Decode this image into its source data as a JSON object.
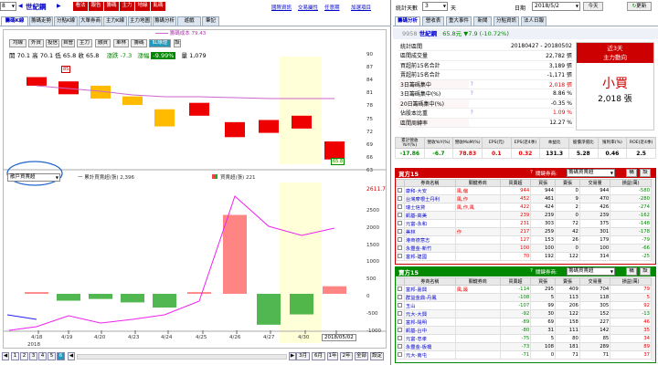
{
  "left": {
    "stock_select": "8",
    "stock_name": "世紀鋼",
    "toolbar": [
      "看法",
      "報告",
      "籌碼",
      "主力",
      "地緣",
      "亂碼"
    ],
    "links": [
      "國際資訊",
      "交易屬性",
      "任意期",
      "加選項目"
    ],
    "tabs": [
      "籌碼K線",
      "籌碼走勢",
      "分點K線",
      "大單券商",
      "主力K線",
      "主力地圖",
      "籌碼分析",
      "遊戲",
      "筆記"
    ],
    "subtabs": [
      "均線",
      "外資",
      "投信",
      "自營",
      "主力",
      "融資",
      "車林",
      "籌碼",
      "紅綠燈",
      "設"
    ],
    "active_subtab": "紅綠燈",
    "ma_legend": "籌碼成本 79.43",
    "ohlc": {
      "open": "開 70.1",
      "high": "高 70.1",
      "low": "低 65.8",
      "close": "收 65.8",
      "chg_label": "漲跌 -7.3",
      "pct_label": "漲幅",
      "pct": "-9.99%",
      "vol_label": "量",
      "vol": "1,079"
    },
    "high_marker": "85",
    "low_marker": "65.8",
    "price_axis": [
      "90",
      "87",
      "84",
      "81",
      "78",
      "75",
      "72",
      "69",
      "66",
      "63"
    ],
    "indicator_select": "散戶買賣超",
    "legend1": "一 累計買賣超(張) 2,396",
    "legend2": "買賣超(張) 221",
    "vol_axis_top": "2611.7",
    "vol_axis": [
      "2500",
      "2000",
      "1500",
      "1000",
      "500",
      "0",
      "-500",
      "-1000"
    ],
    "dates": [
      "4/18",
      "4/19",
      "4/20",
      "4/23",
      "4/24",
      "4/25",
      "4/26",
      "4/27",
      "4/30",
      "5/02"
    ],
    "year": "2018",
    "cursor_date": "2018/05/02",
    "pages": [
      "1",
      "2",
      "3",
      "4",
      "5",
      "6"
    ],
    "active_page": "6",
    "periods": [
      "3月",
      "6月",
      "1年",
      "2年",
      "全部",
      "設定"
    ]
  },
  "right": {
    "top": {
      "date_label": "統計天數",
      "days": "3",
      "days_unit": "天",
      "date_title": "日期",
      "date": "2018/5/2",
      "today": "今天",
      "refresh": "更新"
    },
    "tabs": [
      "籌碼分析",
      "營收表",
      "重大事件",
      "新聞",
      "分點資訊",
      "法人日報"
    ],
    "stock": {
      "code": "9958",
      "name": "世紀鋼",
      "price": "65.8元",
      "change": "▼7.9 (-10.72%)"
    },
    "stats": [
      {
        "label": "統計區間",
        "value": "20180427 - 20180502"
      },
      {
        "label": "區間成交量",
        "value": "22,782 張"
      },
      {
        "label": "買超前15名合計",
        "value": "3,189 張"
      },
      {
        "label": "賣超前15名合計",
        "value": "-1,171 張"
      },
      {
        "label": "3日籌碼集中",
        "value": "2,018 張"
      },
      {
        "label": "3日籌碼集中(%)",
        "value": "8.86 %"
      },
      {
        "label": "20日籌碼集中(%)",
        "value": "-0.35 %"
      },
      {
        "label": "佔股本比重",
        "value": "1.09 %"
      },
      {
        "label": "區間周轉率",
        "value": "12.27 %"
      }
    ],
    "near_box": {
      "title": "近3天",
      "sub": "主力動向",
      "verdict": "小買",
      "amount": "2,018 張"
    },
    "fin_headers": [
      "累計營收YoY(%)",
      "營收YoY(%)",
      "營收MoM(%)",
      "EPS(元)",
      "EPS(近4季)",
      "本益比",
      "股價淨值比",
      "殖利率(%)",
      "ROE(近4季)"
    ],
    "fin_values": [
      "-17.86",
      "-6.7",
      "78.83",
      "0.1",
      "0.32",
      "131.3",
      "5.28",
      "0.46",
      "2.5"
    ],
    "buy": {
      "title": "買方15",
      "help": "?",
      "select_label": "關鍵券商:",
      "select": "籌碼買賣超",
      "btn1": "構",
      "btn2": "設",
      "headers": [
        "",
        "券商名稱",
        "關鍵券商",
        "買賣超",
        "買張",
        "賣張",
        "交易量",
        "損益(萬)"
      ],
      "rows": [
        [
          "",
          "康和-大安",
          "風,偏",
          "944",
          "944",
          "0",
          "944",
          "-580"
        ],
        [
          "",
          "台灣摩根士丹利",
          "風,作",
          "452",
          "461",
          "9",
          "470",
          "-280"
        ],
        [
          "",
          "瑞士信貸",
          "風,作,風",
          "422",
          "424",
          "2",
          "426",
          "-274"
        ],
        [
          "",
          "凱基-高美",
          "",
          "239",
          "239",
          "0",
          "239",
          "-162"
        ],
        [
          "",
          "元富-永和",
          "",
          "231",
          "303",
          "72",
          "375",
          "-148"
        ],
        [
          "",
          "美林",
          "作",
          "217",
          "259",
          "42",
          "301",
          "-178"
        ],
        [
          "",
          "港商德意志",
          "",
          "127",
          "153",
          "26",
          "179",
          "-79"
        ],
        [
          "",
          "永豐金-新竹",
          "",
          "100",
          "100",
          "0",
          "100",
          "-66"
        ],
        [
          "",
          "富邦-建國",
          "",
          "70",
          "192",
          "122",
          "314",
          "-25"
        ]
      ]
    },
    "sell": {
      "title": "賣方15",
      "help": "?",
      "select_label": "關鍵券商:",
      "select": "籌碼買賣超",
      "btn1": "構",
      "btn2": "設",
      "headers": [
        "",
        "券商名稱",
        "關鍵券商",
        "買賣超",
        "買張",
        "賣張",
        "交易量",
        "損益(萬)"
      ],
      "rows": [
        [
          "",
          "富邦-嘉興",
          "風,最",
          "-114",
          "295",
          "409",
          "704",
          "79"
        ],
        [
          "",
          "群益金鼎-丹鳳",
          "",
          "-108",
          "5",
          "113",
          "118",
          "5"
        ],
        [
          "",
          "玉山",
          "",
          "-107",
          "99",
          "206",
          "305",
          "92"
        ],
        [
          "",
          "元大-大興",
          "",
          "-92",
          "30",
          "122",
          "152",
          "-13"
        ],
        [
          "",
          "富邦-陽明",
          "",
          "-89",
          "69",
          "158",
          "227",
          "46"
        ],
        [
          "",
          "凱基-台中",
          "",
          "-80",
          "31",
          "111",
          "142",
          "35"
        ],
        [
          "",
          "元富-忠孝",
          "",
          "-75",
          "5",
          "80",
          "85",
          "34"
        ],
        [
          "",
          "永豐金-板橋",
          "",
          "-73",
          "108",
          "181",
          "289",
          "89"
        ],
        [
          "",
          "元大-南屯",
          "",
          "-71",
          "0",
          "71",
          "71",
          "37"
        ]
      ]
    }
  }
}
